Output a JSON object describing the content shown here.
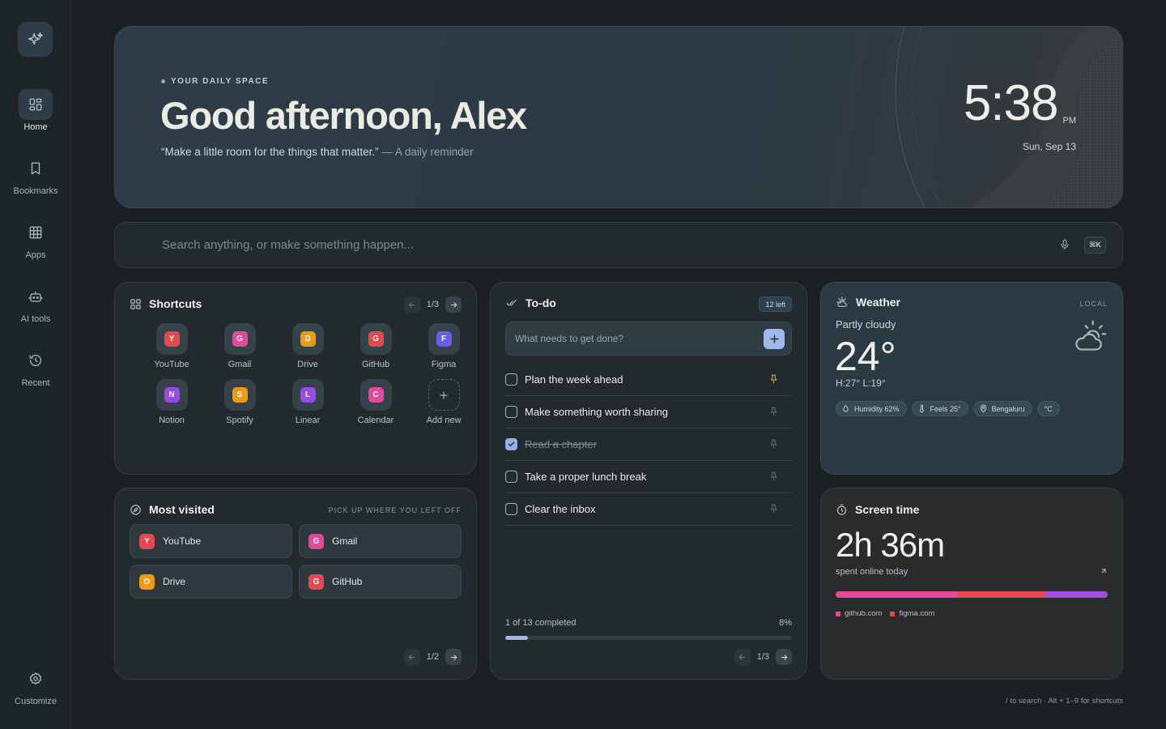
{
  "sidebar": {
    "items": [
      {
        "label": "Home",
        "icon": "grid-icon",
        "active": true
      },
      {
        "label": "Bookmarks",
        "icon": "bookmark-icon"
      },
      {
        "label": "Apps",
        "icon": "apps-icon"
      },
      {
        "label": "AI tools",
        "icon": "robot-icon"
      },
      {
        "label": "Recent",
        "icon": "history-icon"
      }
    ],
    "customize": "Customize"
  },
  "hero": {
    "eyebrow": "YOUR DAILY SPACE",
    "greeting": "Good afternoon, Alex",
    "quote": "“Make a little room for the things that matter.”",
    "quote_attrib": " — A daily reminder",
    "time": "5:38",
    "ampm": "PM",
    "date": "Sun, Sep 13"
  },
  "search": {
    "placeholder": "Search anything, or make something happen...",
    "shortcut": "⌘K"
  },
  "shortcuts": {
    "title": "Shortcuts",
    "page": "1/3",
    "items": [
      {
        "name": "YouTube",
        "letter": "Y",
        "color": "#e5484d"
      },
      {
        "name": "Gmail",
        "letter": "G",
        "color": "#e5489a"
      },
      {
        "name": "Drive",
        "letter": "D",
        "color": "#f09a12"
      },
      {
        "name": "GitHub",
        "letter": "G",
        "color": "#e5484d"
      },
      {
        "name": "Figma",
        "letter": "F",
        "color": "#6a5cf0"
      },
      {
        "name": "Notion",
        "letter": "N",
        "color": "#9a4ae8"
      },
      {
        "name": "Spotify",
        "letter": "S",
        "color": "#f09a12"
      },
      {
        "name": "Linear",
        "letter": "L",
        "color": "#9a4ae8"
      },
      {
        "name": "Calendar",
        "letter": "C",
        "color": "#e5489a"
      }
    ],
    "add_label": "Add new"
  },
  "most_visited": {
    "title": "Most visited",
    "subtitle": "PICK UP WHERE YOU LEFT OFF",
    "page": "1/2",
    "items": [
      {
        "name": "YouTube",
        "letter": "Y",
        "color": "#e5484d"
      },
      {
        "name": "Gmail",
        "letter": "G",
        "color": "#e5489a"
      },
      {
        "name": "Drive",
        "letter": "D",
        "color": "#f09a12"
      },
      {
        "name": "GitHub",
        "letter": "G",
        "color": "#e5484d"
      }
    ]
  },
  "todo": {
    "title": "To-do",
    "count": "12 left",
    "placeholder": "What needs to get done?",
    "items": [
      {
        "text": "Plan the week ahead",
        "done": false,
        "pinned": true
      },
      {
        "text": "Make something worth sharing",
        "done": false,
        "pinned": false
      },
      {
        "text": "Read a chapter",
        "done": true,
        "pinned": false
      },
      {
        "text": "Take a proper lunch break",
        "done": false,
        "pinned": false
      },
      {
        "text": "Clear the inbox",
        "done": false,
        "pinned": false
      }
    ],
    "progress_label": "1 of 13 completed",
    "progress_pct": "8%",
    "progress_fraction": 0.08,
    "page": "1/3"
  },
  "weather": {
    "title": "Weather",
    "tag": "LOCAL",
    "condition": "Partly cloudy",
    "temp": "24°",
    "hilo": "H:27° L:19°",
    "humidity": "Humidity 62%",
    "feels": "Feels 25°",
    "location": "Bengaluru",
    "unit": "°C"
  },
  "screen_time": {
    "title": "Screen time",
    "value": "2h 36m",
    "sub": "spent online today",
    "segments": [
      {
        "share": 0.45,
        "color": "#e8489a"
      },
      {
        "share": 0.32,
        "color": "#e5484d"
      },
      {
        "share": 0.23,
        "color": "#a64ae8"
      }
    ],
    "legend": [
      {
        "label": "github.com",
        "color": "#e8489a"
      },
      {
        "label": "figma.com",
        "color": "#e5484d"
      }
    ]
  },
  "footer_hint": "/ to search · Alt + 1–9 for shortcuts",
  "colors": {
    "accent": "#9db8ea",
    "pin_active": "#e8a23a"
  }
}
